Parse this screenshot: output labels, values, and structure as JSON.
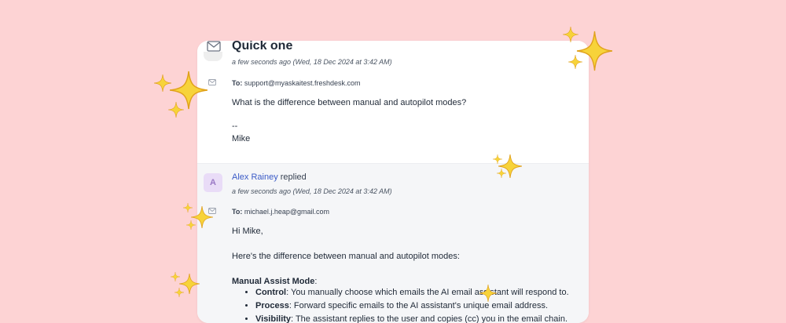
{
  "first_message": {
    "subject": "Quick one",
    "timestamp": "a few seconds ago (Wed, 18 Dec 2024 at 3:42 AM)",
    "to_label": "To:",
    "to_address": "support@myaskaitest.freshdesk.com",
    "body_line1": "What is the difference between manual and autopilot modes?",
    "signature_sep": "--",
    "signature_name": "Mike"
  },
  "reply": {
    "avatar_letter": "A",
    "sender_name": "Alex Rainey",
    "sender_verb": "replied",
    "timestamp": "a few seconds ago (Wed, 18 Dec 2024 at 3:42 AM)",
    "to_label": "To:",
    "to_address": "michael.j.heap@gmail.com",
    "greeting": "Hi Mike,",
    "intro": "Here's the difference between manual and autopilot modes:",
    "section_title": "Manual Assist Mode",
    "section_colon": ":",
    "bullets": [
      {
        "term": "Control",
        "text": ": You manually choose which emails the AI email assistant will respond to."
      },
      {
        "term": "Process",
        "text": ": Forward specific emails to the AI assistant's unique email address."
      },
      {
        "term": "Visibility",
        "text": ": The assistant replies to the user and copies (cc) you in the email chain."
      }
    ]
  },
  "colors": {
    "background": "#fdd3d4",
    "link": "#3b5bc7",
    "sparkle": "#f7d33a",
    "avatar_bg": "#e9dcf7"
  },
  "icons": [
    "envelope-icon",
    "sparkle-icon"
  ]
}
